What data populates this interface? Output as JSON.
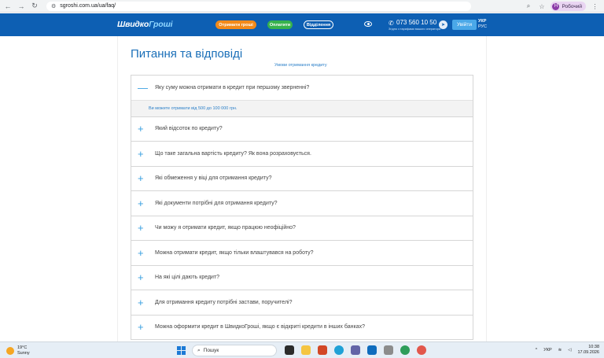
{
  "browser": {
    "url": "sgroshi.com.ua/ua/faq/",
    "profile_label": "Робочий",
    "profile_initial": "Н"
  },
  "header": {
    "logo_main": "Швидко",
    "logo_accent": "Гроші",
    "get_money_label": "Отримати гроші",
    "pay_label": "Оплатити",
    "branches_label": "Відділення",
    "phone": "073 560 10 50",
    "phone_note": "Згідно з тарифами вашого оператора",
    "login_label": "Увійти",
    "lang_ua": "УКР",
    "lang_ru": "РУС"
  },
  "page": {
    "title": "Питання та відповіді",
    "conditions_link": "Умови отримання кредиту"
  },
  "faq": [
    {
      "question": "Яку суму можна отримати в кредит при першому зверненні?",
      "expanded": true,
      "answer": "Ви можете отримати від 500 до 100 000 грн."
    },
    {
      "question": "Який відсоток по кредиту?",
      "expanded": false
    },
    {
      "question": "Що таке загальна вартість кредиту? Як вона розраховується.",
      "expanded": false
    },
    {
      "question": "Які обмеження у віці для отримання кредиту?",
      "expanded": false
    },
    {
      "question": "Які документи потрібні для отримання кредиту?",
      "expanded": false
    },
    {
      "question": "Чи можу я отримати кредит, якщо працюю неофіційно?",
      "expanded": false
    },
    {
      "question": "Можна отримати кредит, якщо тільки влаштувався на роботу?",
      "expanded": false
    },
    {
      "question": "На які цілі дають кредит?",
      "expanded": false
    },
    {
      "question": "Для отримання кредиту потрібні застави, поручителі?",
      "expanded": false
    },
    {
      "question": "Можна оформити кредит в ШвидкоГроші, якщо є відкриті кредити в інших банках?",
      "expanded": false
    }
  ],
  "taskbar": {
    "temperature": "19°C",
    "weather": "Sunny",
    "search_placeholder": "Пошук",
    "language": "УКР",
    "time": "10:38",
    "date": "17.09.2026"
  },
  "colors": {
    "brand_blue": "#0d5fb3",
    "accent_orange": "#f28a1a",
    "accent_green": "#37b24d",
    "link_blue": "#2a7fc8"
  }
}
